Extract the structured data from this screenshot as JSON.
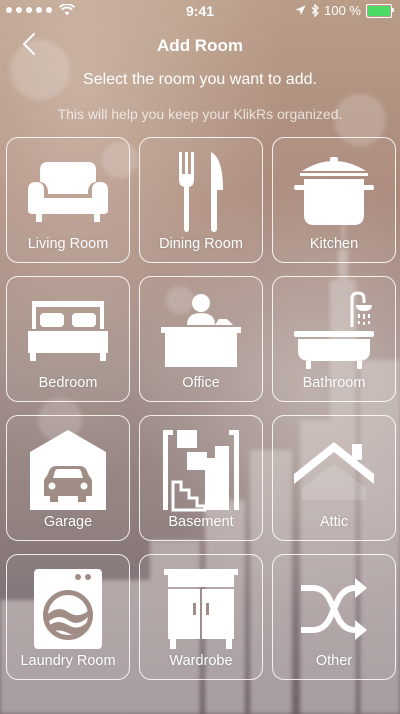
{
  "status_bar": {
    "time": "9:41",
    "battery_percent": "100 %",
    "battery_level": 1.0
  },
  "nav": {
    "title": "Add Room",
    "back_icon": "chevron-left-icon"
  },
  "subtitle": "Select the room you want to add.",
  "hint": "This will help you keep your KlikRs organized.",
  "rooms": [
    {
      "label": "Living Room",
      "icon": "sofa-icon"
    },
    {
      "label": "Dining Room",
      "icon": "fork-knife-icon"
    },
    {
      "label": "Kitchen",
      "icon": "pot-icon"
    },
    {
      "label": "Bedroom",
      "icon": "bed-icon"
    },
    {
      "label": "Office",
      "icon": "desk-person-icon"
    },
    {
      "label": "Bathroom",
      "icon": "bathtub-icon"
    },
    {
      "label": "Garage",
      "icon": "garage-car-icon"
    },
    {
      "label": "Basement",
      "icon": "stairs-icon"
    },
    {
      "label": "Attic",
      "icon": "roof-icon"
    },
    {
      "label": "Laundry Room",
      "icon": "washing-machine-icon"
    },
    {
      "label": "Wardrobe",
      "icon": "wardrobe-icon"
    },
    {
      "label": "Other",
      "icon": "shuffle-icon"
    }
  ]
}
